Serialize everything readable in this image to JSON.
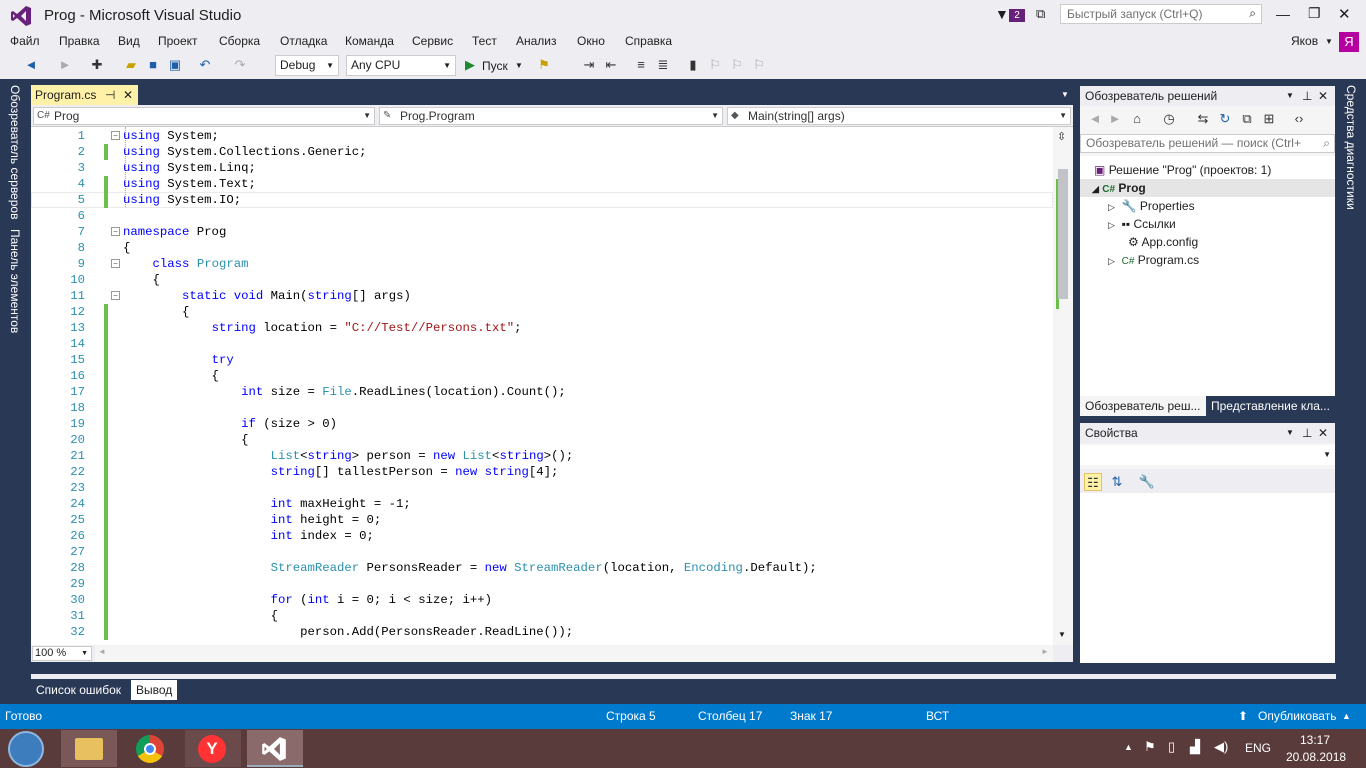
{
  "window": {
    "title": "Prog - Microsoft Visual Studio",
    "notif_count": "2",
    "quick_launch": "Быстрый запуск (Ctrl+Q)",
    "user": "Яков",
    "user_initial": "Я"
  },
  "menu": [
    "Файл",
    "Правка",
    "Вид",
    "Проект",
    "Сборка",
    "Отладка",
    "Команда",
    "Сервис",
    "Тест",
    "Анализ",
    "Окно",
    "Справка"
  ],
  "toolbar": {
    "config": "Debug",
    "platform": "Any CPU",
    "run_label": "Пуск"
  },
  "side_left": {
    "servers": "Обозреватель серверов",
    "toolbox": "Панель элементов"
  },
  "side_right": {
    "diagnostics": "Средства диагностики"
  },
  "doc_tab": {
    "label": "Program.cs",
    "pin": "⊣",
    "close": "✕"
  },
  "navbar": {
    "project": "Prog",
    "class": "Prog.Program",
    "member": "Main(string[] args)"
  },
  "code_lines": [
    {
      "n": "1",
      "t": "using System;"
    },
    {
      "n": "2",
      "t": "using System.Collections.Generic;"
    },
    {
      "n": "3",
      "t": "using System.Linq;"
    },
    {
      "n": "4",
      "t": "using System.Text;"
    },
    {
      "n": "5",
      "t": "using System.IO;"
    },
    {
      "n": "6",
      "t": ""
    },
    {
      "n": "7",
      "t": "namespace Prog"
    },
    {
      "n": "8",
      "t": "{"
    },
    {
      "n": "9",
      "t": "    class Program"
    },
    {
      "n": "10",
      "t": "    {"
    },
    {
      "n": "11",
      "t": "        static void Main(string[] args)"
    },
    {
      "n": "12",
      "t": "        {"
    },
    {
      "n": "13",
      "t": "            string location = \"C://Test//Persons.txt\";"
    },
    {
      "n": "14",
      "t": ""
    },
    {
      "n": "15",
      "t": "            try"
    },
    {
      "n": "16",
      "t": "            {"
    },
    {
      "n": "17",
      "t": "                int size = File.ReadLines(location).Count();"
    },
    {
      "n": "18",
      "t": ""
    },
    {
      "n": "19",
      "t": "                if (size > 0)"
    },
    {
      "n": "20",
      "t": "                {"
    },
    {
      "n": "21",
      "t": "                    List<string> person = new List<string>();"
    },
    {
      "n": "22",
      "t": "                    string[] tallestPerson = new string[4];"
    },
    {
      "n": "23",
      "t": ""
    },
    {
      "n": "24",
      "t": "                    int maxHeight = -1;"
    },
    {
      "n": "25",
      "t": "                    int height = 0;"
    },
    {
      "n": "26",
      "t": "                    int index = 0;"
    },
    {
      "n": "27",
      "t": ""
    },
    {
      "n": "28",
      "t": "                    StreamReader PersonsReader = new StreamReader(location, Encoding.Default);"
    },
    {
      "n": "29",
      "t": ""
    },
    {
      "n": "30",
      "t": "                    for (int i = 0; i < size; i++)"
    },
    {
      "n": "31",
      "t": "                    {"
    },
    {
      "n": "32",
      "t": "                        person.Add(PersonsReader.ReadLine());"
    }
  ],
  "zoom": "100 %",
  "solution_explorer": {
    "title": "Обозреватель решений",
    "search": "Обозреватель решений — поиск (Ctrl+",
    "solution": "Решение \"Prog\"  (проектов: 1)",
    "project": "Prog",
    "items": [
      "Properties",
      "Ссылки",
      "App.config",
      "Program.cs"
    ],
    "tab1": "Обозреватель реш...",
    "tab2": "Представление кла..."
  },
  "properties": {
    "title": "Свойства"
  },
  "bottom_tabs": [
    "Список ошибок",
    "Вывод"
  ],
  "status": {
    "ready": "Готово",
    "line": "Строка 5",
    "col": "Столбец 17",
    "ch": "Знак 17",
    "mode": "ВСТ",
    "publish": "Опубликовать"
  },
  "taskbar": {
    "lang": "ENG",
    "time": "13:17",
    "date": "20.08.2018"
  },
  "colors": {
    "accent": "#007acc",
    "vs_purple": "#68217a",
    "frame": "#293955",
    "changed": "#6cc04a"
  }
}
